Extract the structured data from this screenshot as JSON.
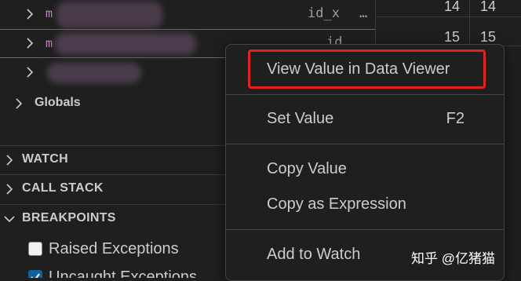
{
  "variables": {
    "rows": [
      {
        "name": "m",
        "type": "id_x",
        "more": "…",
        "values": [
          "14",
          "14"
        ]
      },
      {
        "name": "m",
        "type": "id",
        "values": [
          "15",
          "15"
        ]
      },
      {
        "name": ""
      }
    ],
    "globals_label": "Globals"
  },
  "sections": {
    "watch": "WATCH",
    "call_stack": "CALL STACK",
    "breakpoints": "BREAKPOINTS"
  },
  "breakpoints": [
    {
      "label": "Raised Exceptions",
      "checked": false
    },
    {
      "label": "Uncaught Exceptions",
      "checked": true
    }
  ],
  "context_menu": {
    "view_in_data_viewer": "View Value in Data Viewer",
    "set_value": "Set Value",
    "set_value_shortcut": "F2",
    "copy_value": "Copy Value",
    "copy_as_expression": "Copy as Expression",
    "add_to_watch": "Add to Watch"
  },
  "watermark": "知乎 @亿猪猫",
  "colors": {
    "highlight": "#e0231d",
    "background": "#1f1f1f",
    "variable_name": "#c586c0",
    "selection_border": "#2b79b8"
  }
}
